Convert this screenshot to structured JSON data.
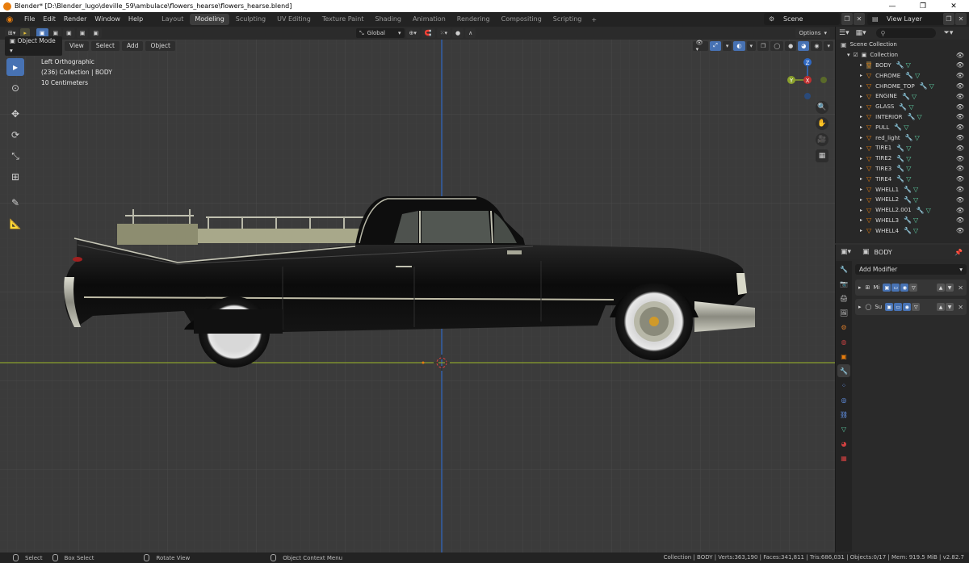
{
  "window": {
    "title": "Blender* [D:\\Blender_lugo\\deville_59\\ambulace\\flowers_hearse\\flowers_hearse.blend]",
    "minimize": "—",
    "maximize": "❐",
    "close": "✕"
  },
  "menubar": {
    "items": [
      "File",
      "Edit",
      "Render",
      "Window",
      "Help"
    ],
    "workspaces": [
      "Layout",
      "Modeling",
      "Sculpting",
      "UV Editing",
      "Texture Paint",
      "Shading",
      "Animation",
      "Rendering",
      "Compositing",
      "Scripting"
    ],
    "active_workspace": "Modeling",
    "add_tab": "+",
    "scene": "Scene",
    "view_layer": "View Layer"
  },
  "viewport": {
    "mode": "Object Mode",
    "menus": [
      "View",
      "Select",
      "Add",
      "Object"
    ],
    "transform_orientation": "Global",
    "options_label": "Options",
    "overlay_lines": [
      "Left Orthographic",
      "(236) Collection | BODY",
      "10 Centimeters"
    ],
    "gizmo": {
      "z": "Z",
      "y": "Y",
      "x": "X"
    }
  },
  "outliner": {
    "scene_collection": "Scene Collection",
    "collection": "Collection",
    "objects": [
      "BODY",
      "CHROME",
      "CHROME_TOP",
      "ENGINE",
      "GLASS",
      "INTERIOR",
      "PULL",
      "red_light",
      "TIRE1",
      "TIRE2",
      "TIRE3",
      "TIRE4",
      "WHELL1",
      "WHELL2",
      "WHELL2.001",
      "WHELL3",
      "WHELL4"
    ]
  },
  "properties": {
    "object_name": "BODY",
    "add_modifier": "Add Modifier",
    "modifiers": [
      {
        "name": "Mi"
      },
      {
        "name": "Su"
      }
    ]
  },
  "statusbar": {
    "select": "Select",
    "box_select": "Box Select",
    "rotate_view": "Rotate View",
    "context_menu": "Object Context Menu",
    "stats": "Collection | BODY | Verts:363,190 | Faces:341,811 | Tris:686,031 | Objects:0/17 | Mem: 919.5 MiB | v2.82.7"
  },
  "colors": {
    "accent": "#4772b3",
    "orange": "#e87d0d",
    "background": "#3b3b3b"
  }
}
